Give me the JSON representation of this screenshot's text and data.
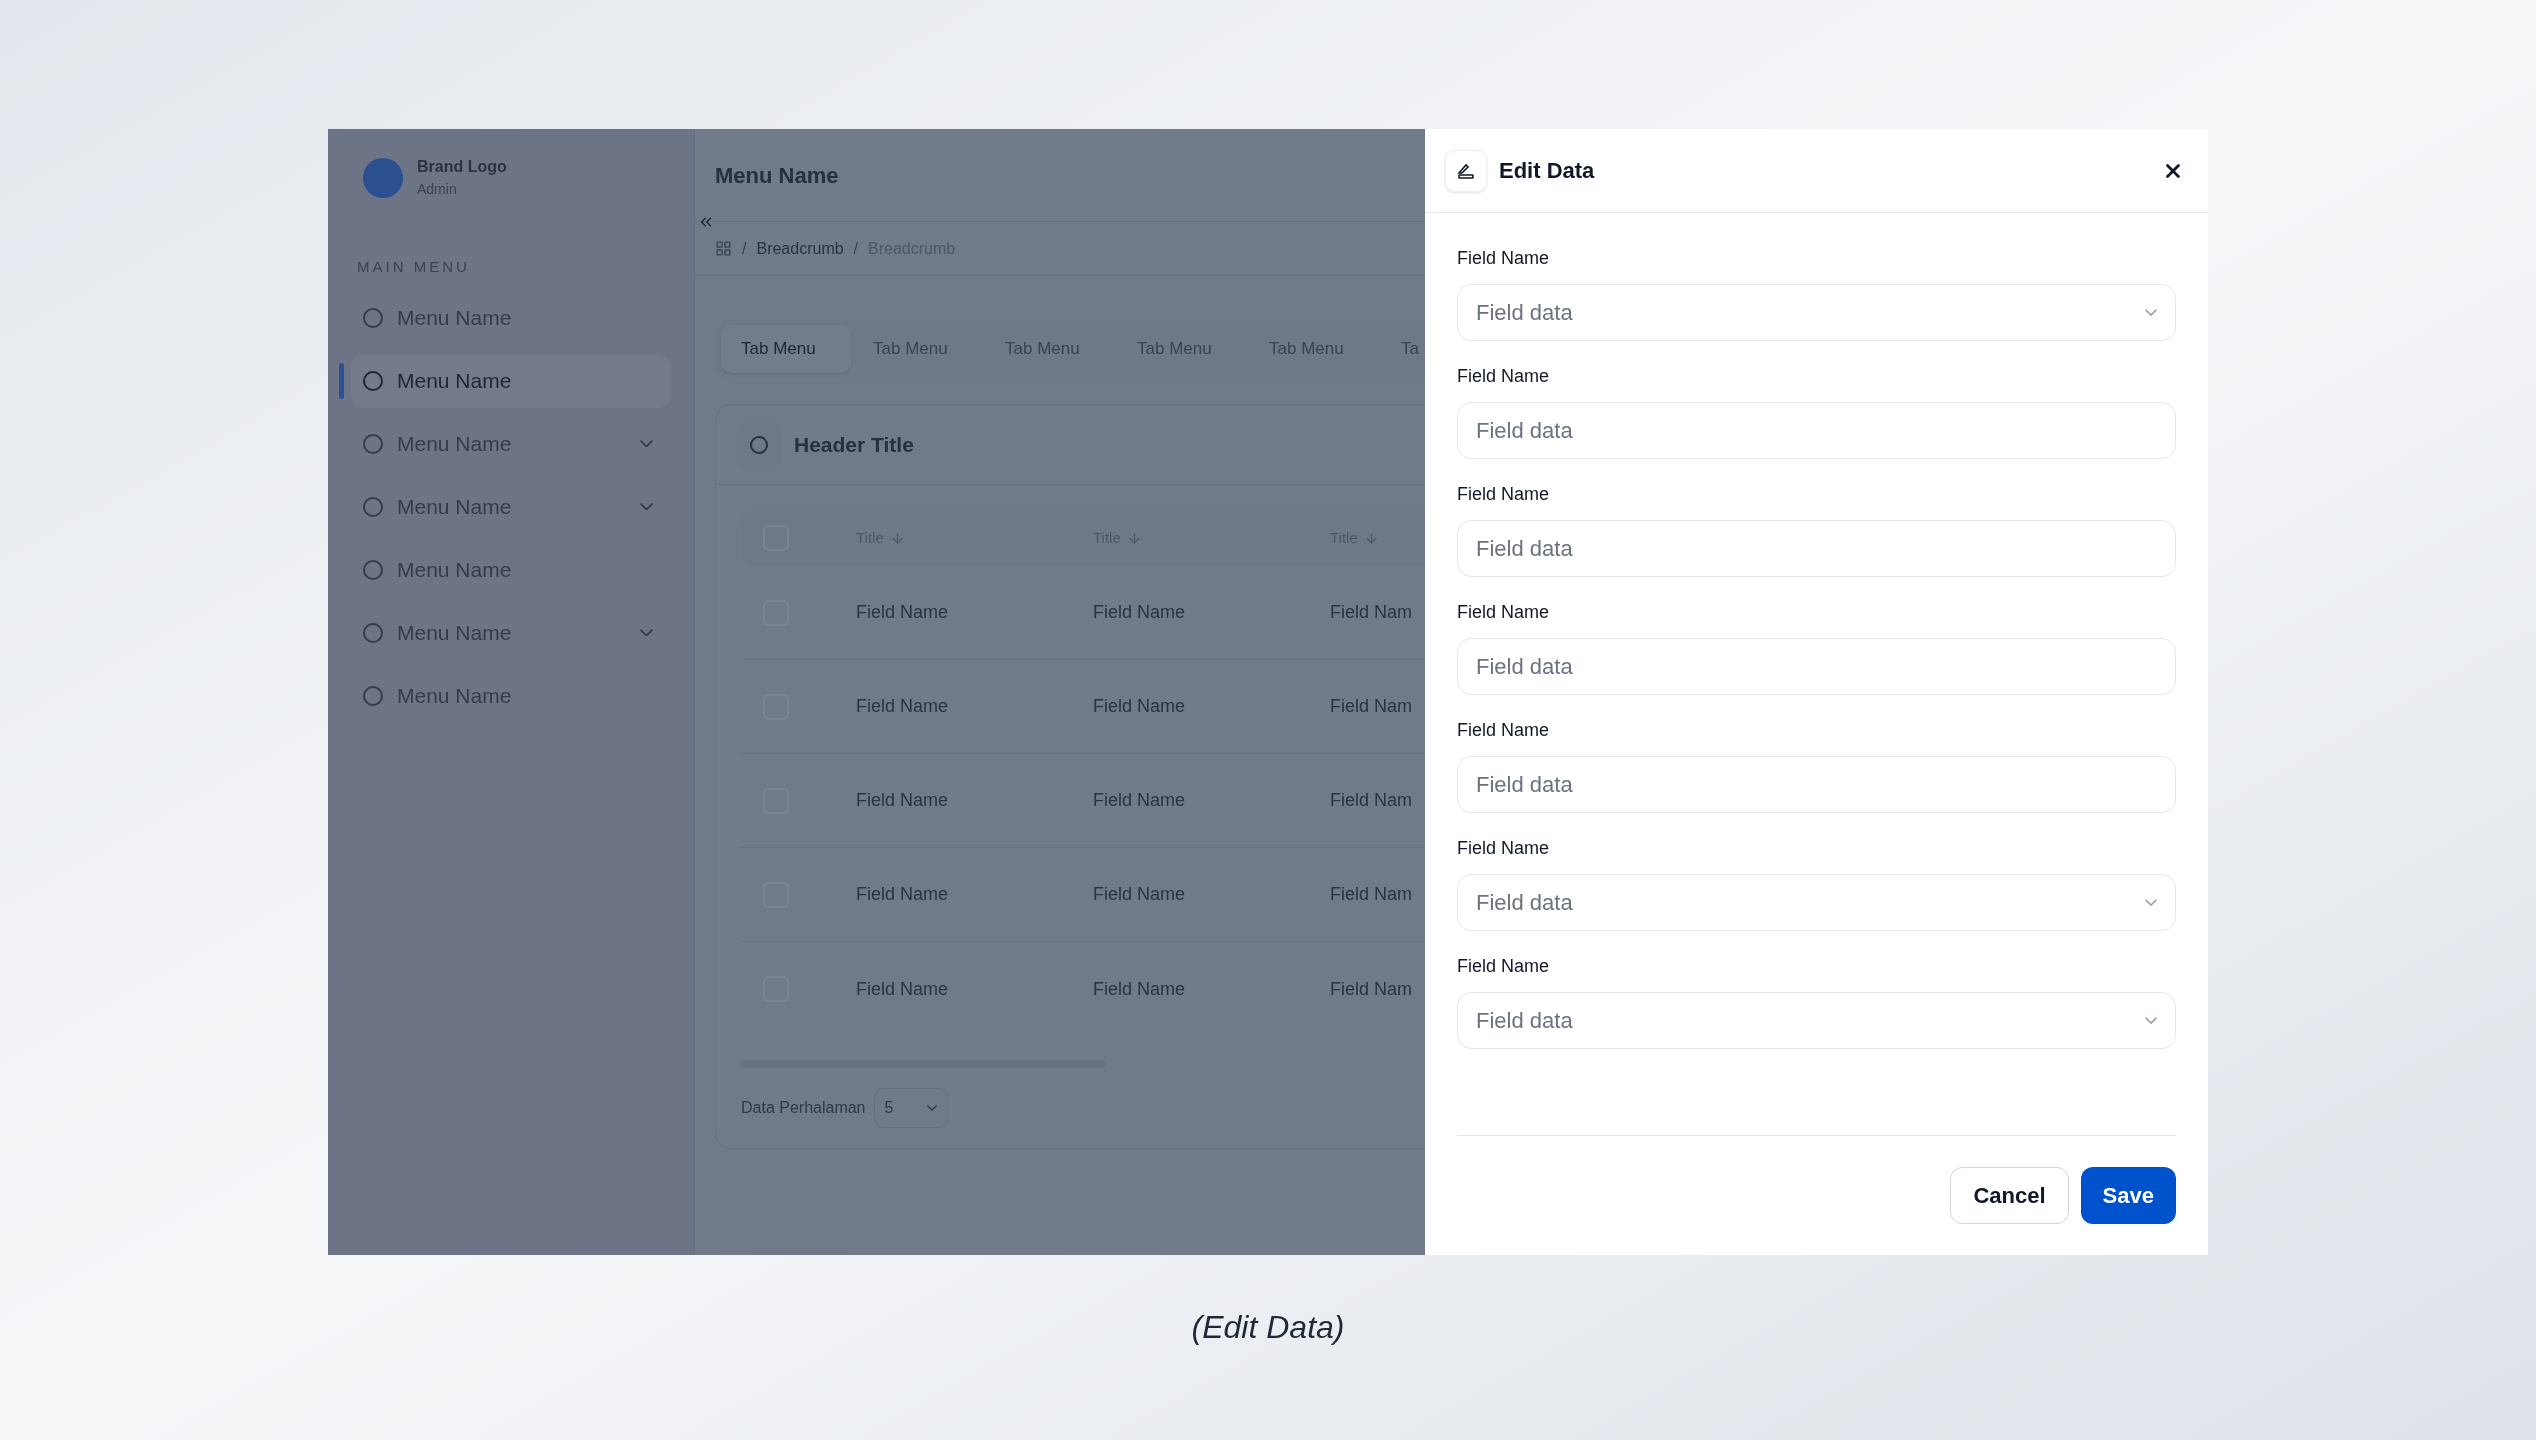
{
  "sidebar": {
    "brand": "Brand Logo",
    "role": "Admin",
    "section": "MAIN MENU",
    "items": [
      {
        "label": "Menu Name",
        "selected": false,
        "expandable": false
      },
      {
        "label": "Menu Name",
        "selected": true,
        "expandable": false
      },
      {
        "label": "Menu Name",
        "selected": false,
        "expandable": true
      },
      {
        "label": "Menu Name",
        "selected": false,
        "expandable": true
      },
      {
        "label": "Menu Name",
        "selected": false,
        "expandable": false
      },
      {
        "label": "Menu Name",
        "selected": false,
        "expandable": true
      },
      {
        "label": "Menu Name",
        "selected": false,
        "expandable": false
      }
    ]
  },
  "header": {
    "title": "Menu Name"
  },
  "breadcrumb": [
    {
      "separator": "/",
      "label": "Breadcrumb",
      "current": false
    },
    {
      "separator": "/",
      "label": "Breadcrumb",
      "current": true
    }
  ],
  "tabs": [
    {
      "label": "Tab Menu",
      "selected": true
    },
    {
      "label": "Tab Menu",
      "selected": false
    },
    {
      "label": "Tab Menu",
      "selected": false
    },
    {
      "label": "Tab Menu",
      "selected": false
    },
    {
      "label": "Tab Menu",
      "selected": false
    },
    {
      "label": "Ta",
      "selected": false
    }
  ],
  "card": {
    "title": "Header Title"
  },
  "table": {
    "columns": [
      "Title",
      "Title",
      "Title"
    ],
    "header_checked": false,
    "rows": [
      {
        "checked": false,
        "cells": [
          "Field Name",
          "Field Name",
          "Field Nam"
        ]
      },
      {
        "checked": false,
        "cells": [
          "Field Name",
          "Field Name",
          "Field Nam"
        ]
      },
      {
        "checked": false,
        "cells": [
          "Field Name",
          "Field Name",
          "Field Nam"
        ]
      },
      {
        "checked": false,
        "cells": [
          "Field Name",
          "Field Name",
          "Field Nam"
        ]
      },
      {
        "checked": false,
        "cells": [
          "Field Name",
          "Field Name",
          "Field Nam"
        ]
      }
    ]
  },
  "pagination": {
    "label": "Data Perhalaman",
    "value": "5"
  },
  "dialog": {
    "title": "Edit Data",
    "fields": [
      {
        "label": "Field Name",
        "kind": "select",
        "placeholder": "Field data"
      },
      {
        "label": "Field Name",
        "kind": "text",
        "placeholder": "Field data"
      },
      {
        "label": "Field Name",
        "kind": "text",
        "placeholder": "Field data"
      },
      {
        "label": "Field Name",
        "kind": "text",
        "placeholder": "Field data"
      },
      {
        "label": "Field Name",
        "kind": "text",
        "placeholder": "Field data"
      },
      {
        "label": "Field Name",
        "kind": "select",
        "placeholder": "Field data"
      },
      {
        "label": "Field Name",
        "kind": "select",
        "placeholder": "Field data"
      }
    ],
    "buttons": [
      {
        "label": "Cancel",
        "kind": "secondary"
      },
      {
        "label": "Save",
        "kind": "primary"
      }
    ]
  },
  "caption": "(Edit Data)"
}
